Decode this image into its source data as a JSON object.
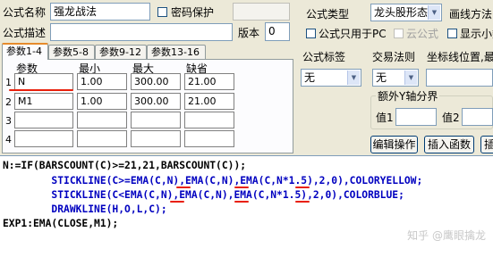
{
  "formula": {
    "name_label": "公式名称",
    "name_value": "强龙战法",
    "password_label": "密码保护",
    "desc_label": "公式描述",
    "desc_value": "",
    "version_label": "版本",
    "version_value": "0",
    "type_label": "公式类型",
    "type_value": "龙头股形态",
    "draw_label": "画线方法",
    "pc_only_label": "公式只用于PC",
    "cloud_label": "云公式",
    "show_small_label": "显示小数",
    "tag_label": "公式标签",
    "tag_value": "无",
    "trade_rule_label": "交易法则",
    "trade_rule_value": "无",
    "coord_label": "坐标线位置,最",
    "extra_axis_label": "额外Y轴分界",
    "val1_label": "值1",
    "val2_label": "值2",
    "edit_btn": "编辑操作",
    "insert_fn_btn": "插入函数",
    "extra_btn": "插"
  },
  "tabs": [
    "参数1-4",
    "参数5-8",
    "参数9-12",
    "参数13-16"
  ],
  "params": {
    "headers": [
      "参数",
      "最小",
      "最大",
      "缺省"
    ],
    "rows": [
      {
        "num": "1",
        "name": "N",
        "min": "1.00",
        "max": "300.00",
        "def": "21.00"
      },
      {
        "num": "2",
        "name": "M1",
        "min": "1.00",
        "max": "300.00",
        "def": "21.00"
      },
      {
        "num": "3",
        "name": "",
        "min": "",
        "max": "",
        "def": ""
      },
      {
        "num": "4",
        "name": "",
        "min": "",
        "max": "",
        "def": ""
      }
    ]
  },
  "code": [
    "N:=IF(BARSCOUNT(C)>=21,21,BARSCOUNT(C));",
    "        STICKLINE(C>=EMA(C,N),EMA(C,N),EMA(C,N*1.5),2,0),COLORYELLOW;",
    "        STICKLINE(C<EMA(C,N),EMA(C,N),EMA(C,N*1.5),2,0),COLORBLUE;",
    "        DRAWKLINE(H,O,L,C);",
    "EXP1:EMA(CLOSE,M1);"
  ],
  "watermark": "知乎 @鹰眼擒龙",
  "colors": {
    "underline": "#e8200c",
    "tab_accent": "#e68b2c",
    "window_bg": "#ece9d8"
  }
}
